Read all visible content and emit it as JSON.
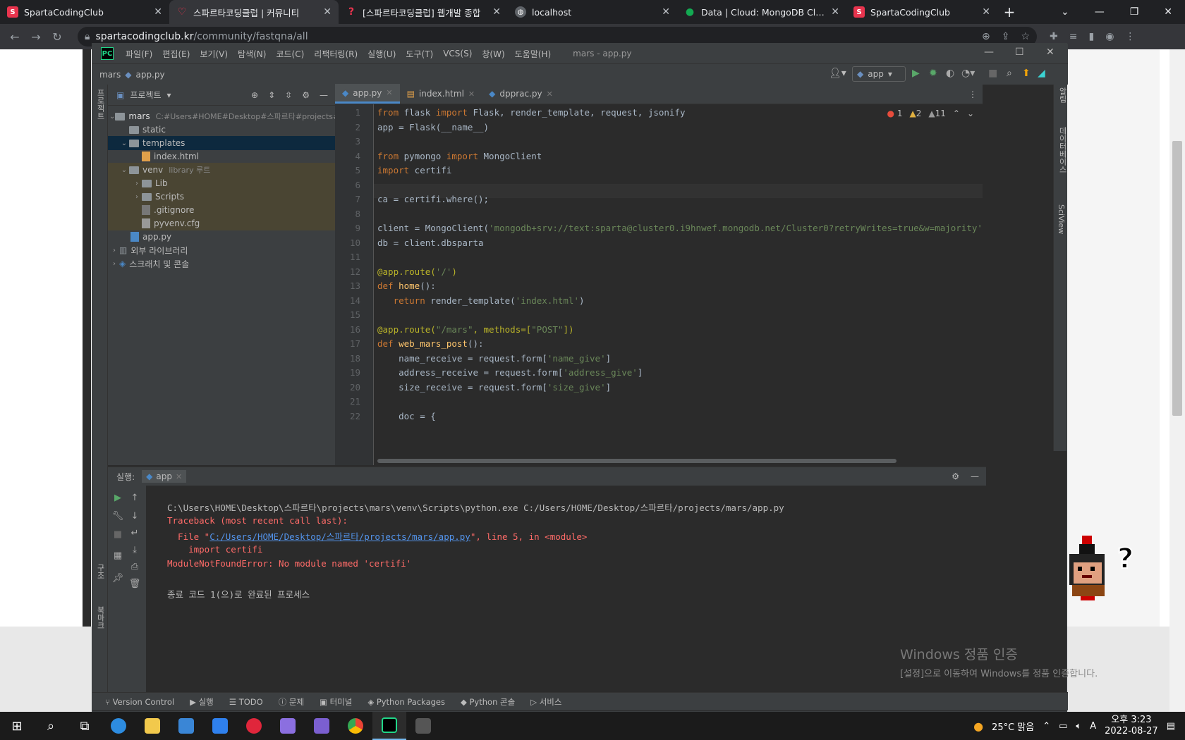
{
  "browser": {
    "tabs": [
      {
        "title": "SpartaCodingClub",
        "active": false
      },
      {
        "title": "스파르타코딩클럽 | 커뮤니티",
        "active": true
      },
      {
        "title": "[스파르타코딩클럽] 웹개발 종합",
        "active": false
      },
      {
        "title": "localhost",
        "active": false
      },
      {
        "title": "Data | Cloud: MongoDB Cloud",
        "active": false
      },
      {
        "title": "SpartaCodingClub",
        "active": false
      }
    ],
    "url_host": "spartacodingclub.kr",
    "url_path": "/community/fastqna/all"
  },
  "ide": {
    "menus": [
      "파일(F)",
      "편집(E)",
      "보기(V)",
      "탐색(N)",
      "코드(C)",
      "리팩터링(R)",
      "실행(U)",
      "도구(T)",
      "VCS(S)",
      "창(W)",
      "도움말(H)"
    ],
    "window_title": "mars - app.py",
    "breadcrumb": {
      "project": "mars",
      "file": "app.py"
    },
    "run_config": "app",
    "left_strip": {
      "top": "프로젝트",
      "mid": "구조",
      "bot": "북마크"
    },
    "right_strip": {
      "db": "데이터베이스",
      "sci": "SciView",
      "hint": "알림"
    },
    "project_panel": {
      "title": "프로젝트",
      "root": "mars",
      "root_path": "C:#Users#HOME#Desktop#스파르타#projects#m",
      "items": [
        {
          "label": "static",
          "depth": 1,
          "type": "folder"
        },
        {
          "label": "templates",
          "depth": 1,
          "type": "folder"
        },
        {
          "label": "index.html",
          "depth": 2,
          "type": "html"
        },
        {
          "label": "venv",
          "depth": 1,
          "type": "folder",
          "note": "library 루트"
        },
        {
          "label": "Lib",
          "depth": 2,
          "type": "folder"
        },
        {
          "label": "Scripts",
          "depth": 2,
          "type": "folder"
        },
        {
          "label": ".gitignore",
          "depth": 2,
          "type": "file"
        },
        {
          "label": "pyvenv.cfg",
          "depth": 2,
          "type": "file"
        },
        {
          "label": "app.py",
          "depth": 1,
          "type": "py"
        },
        {
          "label": "외부 라이브러리",
          "depth": 0,
          "type": "lib"
        },
        {
          "label": "스크래치 및 콘솔",
          "depth": 0,
          "type": "scratch"
        }
      ]
    },
    "editor_tabs": [
      "app.py",
      "index.html",
      "dpprac.py"
    ],
    "inspections": {
      "errors": "1",
      "warnings": "2",
      "weak": "11"
    },
    "code_lines": [
      {
        "n": "1",
        "text": "from flask import Flask, render_template, request, jsonify"
      },
      {
        "n": "2",
        "text": "app = Flask(__name__)"
      },
      {
        "n": "3",
        "text": ""
      },
      {
        "n": "4",
        "text": "from pymongo import MongoClient"
      },
      {
        "n": "5",
        "text": "import certifi"
      },
      {
        "n": "6",
        "text": ""
      },
      {
        "n": "7",
        "text": "ca = certifi.where();"
      },
      {
        "n": "8",
        "text": ""
      },
      {
        "n": "9",
        "text": "client = MongoClient('mongodb+srv://text:sparta@cluster0.i9hnwef.mongodb.net/Cluster0?retryWrites=true&w=majority'"
      },
      {
        "n": "10",
        "text": "db = client.dbsparta"
      },
      {
        "n": "11",
        "text": ""
      },
      {
        "n": "12",
        "text": "@app.route('/')"
      },
      {
        "n": "13",
        "text": "def home():"
      },
      {
        "n": "14",
        "text": "   return render_template('index.html')"
      },
      {
        "n": "15",
        "text": ""
      },
      {
        "n": "16",
        "text": "@app.route(\"/mars\", methods=[\"POST\"])"
      },
      {
        "n": "17",
        "text": "def web_mars_post():"
      },
      {
        "n": "18",
        "text": "    name_receive = request.form['name_give']"
      },
      {
        "n": "19",
        "text": "    address_receive = request.form['address_give']"
      },
      {
        "n": "20",
        "text": "    size_receive = request.form['size_give']"
      },
      {
        "n": "21",
        "text": ""
      },
      {
        "n": "22",
        "text": "    doc = {"
      }
    ],
    "run_panel": {
      "label": "실행:",
      "config": "app",
      "output": [
        {
          "kind": "norm",
          "text": "C:\\Users\\HOME\\Desktop\\스파르타\\projects\\mars\\venv\\Scripts\\python.exe C:/Users/HOME/Desktop/스파르타/projects/mars/app.py"
        },
        {
          "kind": "err",
          "text": "Traceback (most recent call last):"
        },
        {
          "kind": "err_file",
          "prefix": "  File \"",
          "link": "C:/Users/HOME/Desktop/스파르타/projects/mars/app.py",
          "suffix": "\", line 5, in <module>"
        },
        {
          "kind": "err",
          "text": "    import certifi"
        },
        {
          "kind": "err",
          "text": "ModuleNotFoundError: No module named 'certifi'"
        },
        {
          "kind": "norm",
          "text": ""
        },
        {
          "kind": "norm",
          "text": "종료 코드 1(으)로 완료된 프로세스"
        }
      ]
    },
    "bottom_tools": [
      "Version Control",
      "실행",
      "TODO",
      "문제",
      "터미널",
      "Python Packages",
      "Python 콘솔",
      "서비스"
    ]
  },
  "activation": {
    "title": "Windows 정품 인증",
    "message": "[설정]으로 이동하여 Windows를 정품 인증합니다."
  },
  "taskbar": {
    "weather": "25°C 맑음",
    "time": "오후 3:23",
    "date": "2022-08-27",
    "ime": "A"
  }
}
